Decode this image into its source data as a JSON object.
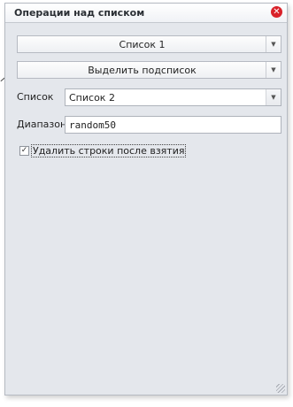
{
  "window": {
    "title": "Операции над списком",
    "close_glyph": "✕"
  },
  "source_list": {
    "value": "Список 1",
    "arrow": "▼"
  },
  "action": {
    "value": "Выделить подсписок",
    "arrow": "▼"
  },
  "target_list": {
    "label": "Список",
    "value": "Список 2",
    "arrow": "▼"
  },
  "range": {
    "label": "Диапазон",
    "value": "random50"
  },
  "remove_rows": {
    "label": "Удалить строки после взятия",
    "checked": true,
    "check_glyph": "✓"
  }
}
